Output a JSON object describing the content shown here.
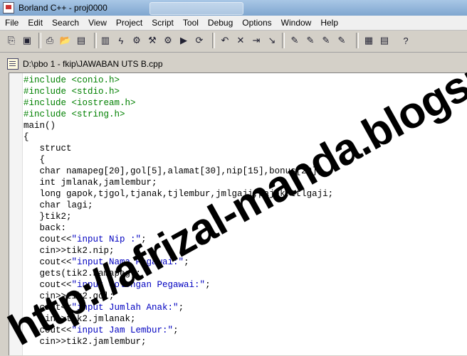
{
  "window": {
    "title": "Borland C++ - proj0000"
  },
  "menu": [
    "File",
    "Edit",
    "Search",
    "View",
    "Project",
    "Script",
    "Tool",
    "Debug",
    "Options",
    "Window",
    "Help"
  ],
  "toolbar_icons": [
    "open-project-icon",
    "save-icon",
    "print-icon",
    "open-file-icon",
    "save-file-icon",
    "close-file-icon",
    "lightning-icon",
    "compile-icon",
    "make-icon",
    "build-icon",
    "run-icon",
    "rebuild-icon",
    "step-back-icon",
    "stop-icon",
    "step-over-icon",
    "step-into-icon",
    "breakpoint-icon",
    "watch-icon",
    "inspect-icon",
    "evaluate-icon",
    "layout-icon",
    "windows-icon",
    "help-icon"
  ],
  "document": {
    "path": "D:\\pbo 1 - fkip\\JAWABAN UTS B.cpp"
  },
  "code": {
    "lines": [
      {
        "indent": "",
        "parts": [
          {
            "t": "#include <conio.h>",
            "c": "pp"
          }
        ]
      },
      {
        "indent": "",
        "parts": [
          {
            "t": "#include <stdio.h>",
            "c": "pp"
          }
        ]
      },
      {
        "indent": "",
        "parts": [
          {
            "t": "#include <iostream.h>",
            "c": "pp"
          }
        ]
      },
      {
        "indent": "",
        "parts": [
          {
            "t": "#include <string.h>",
            "c": "pp"
          }
        ]
      },
      {
        "indent": "",
        "parts": [
          {
            "t": "main()",
            "c": ""
          }
        ]
      },
      {
        "indent": "",
        "parts": [
          {
            "t": "{",
            "c": ""
          }
        ]
      },
      {
        "indent": "   ",
        "parts": [
          {
            "t": "struct",
            "c": ""
          }
        ]
      },
      {
        "indent": "   ",
        "parts": [
          {
            "t": "{",
            "c": ""
          }
        ]
      },
      {
        "indent": "   ",
        "parts": [
          {
            "t": "char namapeg[20],gol[5],alamat[30],nip[15],bonus[20];",
            "c": ""
          }
        ]
      },
      {
        "indent": "   ",
        "parts": [
          {
            "t": "int jmlanak,jamlembur;",
            "c": ""
          }
        ]
      },
      {
        "indent": "   ",
        "parts": [
          {
            "t": "long gapok,tjgol,tjanak,tjlembur,jmlgaji,pajak,ttlgaji;",
            "c": ""
          }
        ]
      },
      {
        "indent": "   ",
        "parts": [
          {
            "t": "char lagi;",
            "c": ""
          }
        ]
      },
      {
        "indent": "   ",
        "parts": [
          {
            "t": "}tik2;",
            "c": ""
          }
        ]
      },
      {
        "indent": "   ",
        "parts": [
          {
            "t": "back:",
            "c": ""
          }
        ]
      },
      {
        "indent": "   ",
        "parts": [
          {
            "t": "cout<<",
            "c": ""
          },
          {
            "t": "\"input Nip :\"",
            "c": "str"
          },
          {
            "t": ";",
            "c": ""
          }
        ]
      },
      {
        "indent": "   ",
        "parts": [
          {
            "t": "cin>>tik2.nip;",
            "c": ""
          }
        ]
      },
      {
        "indent": "   ",
        "parts": [
          {
            "t": "cout<<",
            "c": ""
          },
          {
            "t": "\"input Nama Pegawai:\"",
            "c": "str"
          },
          {
            "t": ";",
            "c": ""
          }
        ]
      },
      {
        "indent": "   ",
        "parts": [
          {
            "t": "gets(tik2.namapeg);",
            "c": ""
          }
        ]
      },
      {
        "indent": "   ",
        "parts": [
          {
            "t": "cout<<",
            "c": ""
          },
          {
            "t": "\"input Golongan Pegawai:\"",
            "c": "str"
          },
          {
            "t": ";",
            "c": ""
          }
        ]
      },
      {
        "indent": "   ",
        "parts": [
          {
            "t": "cin>>tik2.gol;",
            "c": ""
          }
        ]
      },
      {
        "indent": "   ",
        "parts": [
          {
            "t": "cout<<",
            "c": ""
          },
          {
            "t": "\"input Jumlah Anak:\"",
            "c": "str"
          },
          {
            "t": ";",
            "c": ""
          }
        ]
      },
      {
        "indent": "   ",
        "parts": [
          {
            "t": "cin>>tik2.jmlanak;",
            "c": ""
          }
        ]
      },
      {
        "indent": "   ",
        "parts": [
          {
            "t": "cout<<",
            "c": ""
          },
          {
            "t": "\"input Jam Lembur:\"",
            "c": "str"
          },
          {
            "t": ";",
            "c": ""
          }
        ]
      },
      {
        "indent": "   ",
        "parts": [
          {
            "t": "cin>>tik2.jamlembur;",
            "c": ""
          }
        ]
      }
    ]
  },
  "watermark": {
    "text": "http://afrizal-manda.blogspot.com"
  }
}
